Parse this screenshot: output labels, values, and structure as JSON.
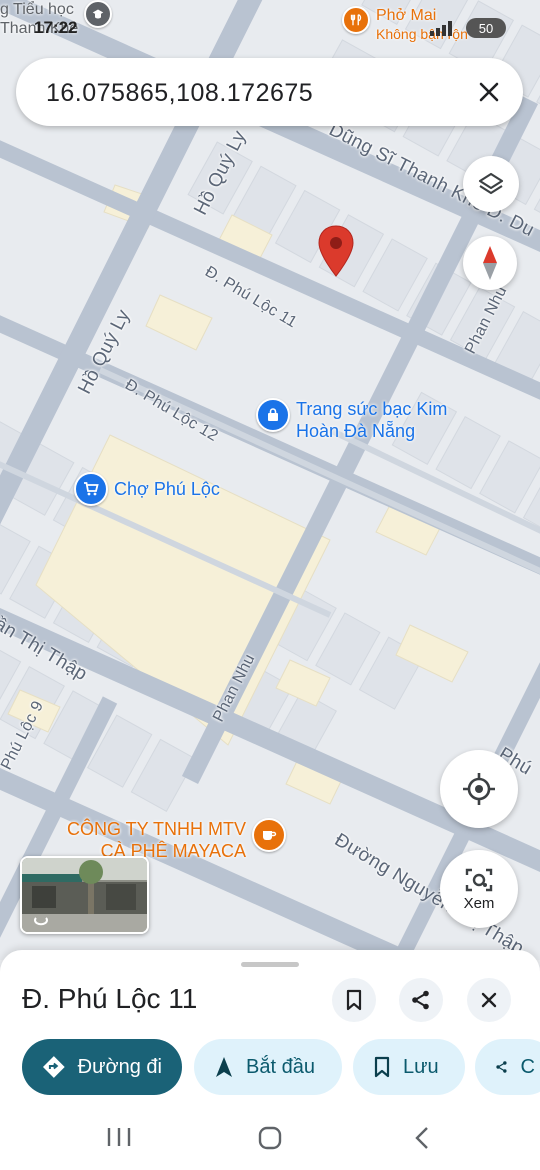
{
  "status_bar": {
    "time": "17:22",
    "battery": "50"
  },
  "search": {
    "value": "16.075865,108.172675"
  },
  "map": {
    "streets": [
      {
        "id": "ho-quy-ly-top",
        "name": "Hồ Quý Ly"
      },
      {
        "id": "ho-quy-ly-mid",
        "name": "Hồ Quý Ly"
      },
      {
        "id": "dung-si-thanh-khe",
        "name": "Dũng Sĩ Thanh Khê Đ. Du"
      },
      {
        "id": "phu-loc-11",
        "name": "Đ. Phú Lộc 11"
      },
      {
        "id": "phan-nhu-top",
        "name": "Phan Nhu"
      },
      {
        "id": "phu-loc-12",
        "name": "Đ. Phú Lộc 12"
      },
      {
        "id": "phan-nhu-bottom",
        "name": "Phan Nhu"
      },
      {
        "id": "tran-thi-thap",
        "name": "ần Thị Thập"
      },
      {
        "id": "phu-loc-9",
        "name": "Phú Lộc 9"
      },
      {
        "id": "nguyen-thi-thap",
        "name": "Đường Nguyễn Thị Thập"
      },
      {
        "id": "phu-right",
        "name": "Phú"
      }
    ],
    "pois": [
      {
        "id": "trang-suc",
        "lines": [
          "Trang sức bạc Kim",
          "Hoàn Đà Nẵng"
        ],
        "icon": "shopping-bag-icon",
        "color": "#1a73e8"
      },
      {
        "id": "cho-phu-loc",
        "lines": [
          "Chợ Phú Lộc"
        ],
        "icon": "shopping-cart-icon",
        "color": "#1a73e8"
      },
      {
        "id": "ca-phe",
        "lines": [
          "CÔNG TY TNHH MTV",
          "CÀ PHÊ MAYACA"
        ],
        "icon": "coffee-cup-icon",
        "color": "#e8710a"
      },
      {
        "id": "pho-mai",
        "lines": [
          "Phở Mai",
          "Không bận rộn"
        ],
        "icon": "restaurant-icon",
        "color": "#e8710a"
      },
      {
        "id": "tieu-hoc",
        "lines": [
          "g Tiểu học",
          "Thanh Khê"
        ],
        "icon": "school-icon",
        "color": "#5f6368"
      }
    ],
    "recenter_label": "Xem"
  },
  "place": {
    "title": "Đ. Phú Lộc 11"
  },
  "actions": {
    "directions": "Đường đi",
    "start": "Bắt đầu",
    "save": "Lưu",
    "share": "C"
  },
  "colors": {
    "primary": "#1a6277",
    "chip_bg": "#dff2fb",
    "pin": "#db3a2c",
    "road": "#b9c3d1"
  }
}
